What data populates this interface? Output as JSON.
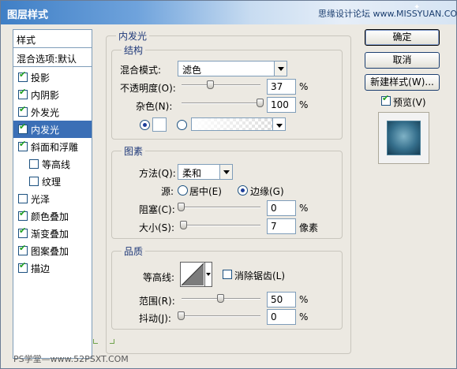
{
  "window": {
    "title": "图层样式",
    "watermark_top": "思缘设计论坛 www.MISSYUAN.COM",
    "watermark_bottom": "PS学堂—www.52PSXT.COM"
  },
  "style_list": {
    "header": "样式",
    "blend_options": "混合选项:默认",
    "items": [
      {
        "label": "投影",
        "checked": true
      },
      {
        "label": "内阴影",
        "checked": true
      },
      {
        "label": "外发光",
        "checked": true
      },
      {
        "label": "内发光",
        "checked": true,
        "selected": true
      },
      {
        "label": "斜面和浮雕",
        "checked": true
      },
      {
        "label": "等高线",
        "checked": false,
        "sub": true
      },
      {
        "label": "纹理",
        "checked": false,
        "sub": true
      },
      {
        "label": "光泽",
        "checked": false
      },
      {
        "label": "颜色叠加",
        "checked": true
      },
      {
        "label": "渐变叠加",
        "checked": true
      },
      {
        "label": "图案叠加",
        "checked": true
      },
      {
        "label": "描边",
        "checked": true
      }
    ]
  },
  "panel": {
    "title": "内发光",
    "structure": {
      "title": "结构",
      "blend_mode_label": "混合模式:",
      "blend_mode_value": "滤色",
      "opacity_label": "不透明度(O):",
      "opacity_value": "37",
      "opacity_unit": "%",
      "opacity_fraction": 0.37,
      "noise_label": "杂色(N):",
      "noise_value": "100",
      "noise_unit": "%",
      "noise_fraction": 1.0,
      "color_swatch": "#ffffff"
    },
    "elements": {
      "title": "图素",
      "method_label": "方法(Q):",
      "method_value": "柔和",
      "source_label": "源:",
      "source_center": "居中(E)",
      "source_edge": "边缘(G)",
      "choke_label": "阻塞(C):",
      "choke_value": "0",
      "choke_unit": "%",
      "choke_fraction": 0.0,
      "size_label": "大小(S):",
      "size_value": "7",
      "size_unit": "像素",
      "size_fraction": 0.03
    },
    "quality": {
      "title": "品质",
      "contour_label": "等高线:",
      "anti_alias_label": "消除锯齿(L)",
      "range_label": "范围(R):",
      "range_value": "50",
      "range_unit": "%",
      "range_fraction": 0.5,
      "jitter_label": "抖动(J):",
      "jitter_value": "0",
      "jitter_unit": "%",
      "jitter_fraction": 0.0
    }
  },
  "buttons": {
    "ok": "确定",
    "cancel": "取消",
    "new_style": "新建样式(W)...",
    "preview_label": "预览(V)"
  },
  "colors": {
    "accent_selected": "#3b6fb6",
    "titlebar": "#3f7fc6",
    "group_title": "#203a7a"
  }
}
